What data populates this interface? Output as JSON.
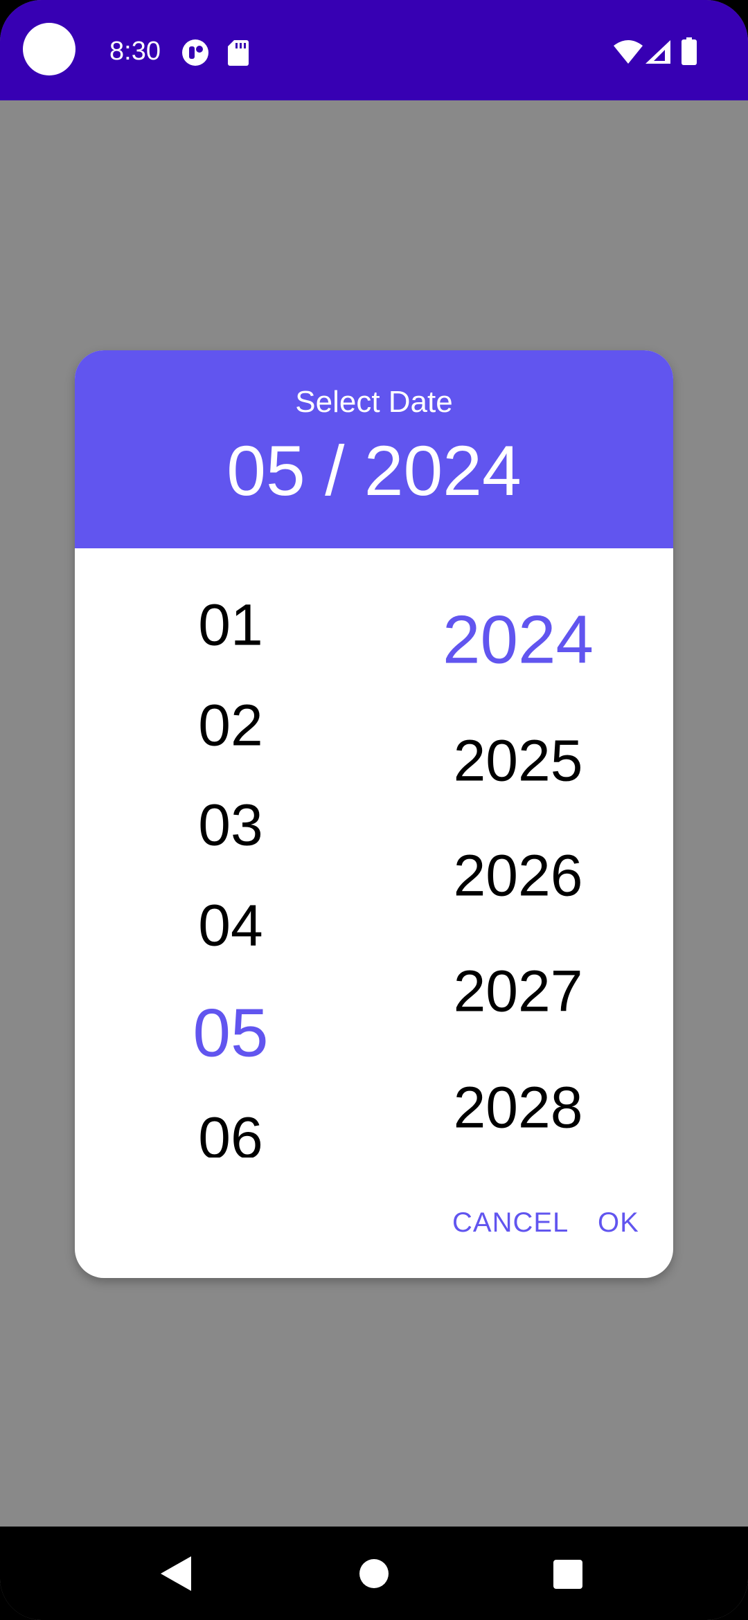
{
  "status_bar": {
    "time": "8:30",
    "icons": [
      "notification-app-icon",
      "sd-card-icon",
      "wifi-icon",
      "signal-icon",
      "battery-icon"
    ]
  },
  "dialog": {
    "title": "Select Date",
    "value": "05 / 2024",
    "months": [
      "01",
      "02",
      "03",
      "04",
      "05",
      "06"
    ],
    "selected_month": "05",
    "years": [
      "2024",
      "2025",
      "2026",
      "2027",
      "2028"
    ],
    "selected_year": "2024",
    "actions": {
      "cancel_label": "CANCEL",
      "ok_label": "OK"
    }
  },
  "nav_bar": {
    "buttons": [
      "back-icon",
      "home-icon",
      "recents-icon"
    ]
  },
  "colors": {
    "status_bar": "#3700b3",
    "accent": "#6155ef",
    "scrim": "#898989",
    "nav_bar": "#000000"
  }
}
